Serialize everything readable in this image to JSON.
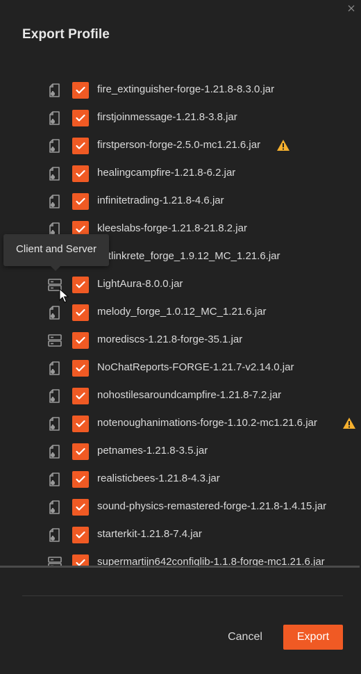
{
  "dialog": {
    "title": "Export Profile",
    "close_icon": "close-icon"
  },
  "mods": [
    {
      "name": "fire_extinguisher-forge-1.21.8-8.3.0.jar",
      "side": "client",
      "checked": true,
      "warning": false
    },
    {
      "name": "firstjoinmessage-1.21.8-3.8.jar",
      "side": "client",
      "checked": true,
      "warning": false
    },
    {
      "name": "firstperson-forge-2.5.0-mc1.21.6.jar",
      "side": "client",
      "checked": true,
      "warning": true
    },
    {
      "name": "healingcampfire-1.21.8-6.2.jar",
      "side": "client",
      "checked": true,
      "warning": false
    },
    {
      "name": "infinitetrading-1.21.8-4.6.jar",
      "side": "client",
      "checked": true,
      "warning": false
    },
    {
      "name": "kleeslabs-forge-1.21.8-21.8.2.jar",
      "side": "client",
      "checked": true,
      "warning": false
    },
    {
      "name": "kotlinkrete_forge_1.9.12_MC_1.21.6.jar",
      "side": "client",
      "checked": true,
      "warning": false
    },
    {
      "name": "LightAura-8.0.0.jar",
      "side": "both",
      "checked": true,
      "warning": false
    },
    {
      "name": "melody_forge_1.0.12_MC_1.21.6.jar",
      "side": "client",
      "checked": true,
      "warning": false
    },
    {
      "name": "morediscs-1.21.8-forge-35.1.jar",
      "side": "both",
      "checked": true,
      "warning": false
    },
    {
      "name": "NoChatReports-FORGE-1.21.7-v2.14.0.jar",
      "side": "client",
      "checked": true,
      "warning": false
    },
    {
      "name": "nohostilesaroundcampfire-1.21.8-7.2.jar",
      "side": "client",
      "checked": true,
      "warning": false
    },
    {
      "name": "notenoughanimations-forge-1.10.2-mc1.21.6.jar",
      "side": "client",
      "checked": true,
      "warning": true
    },
    {
      "name": "petnames-1.21.8-3.5.jar",
      "side": "client",
      "checked": true,
      "warning": false
    },
    {
      "name": "realisticbees-1.21.8-4.3.jar",
      "side": "client",
      "checked": true,
      "warning": false
    },
    {
      "name": "sound-physics-remastered-forge-1.21.8-1.4.15.jar",
      "side": "client",
      "checked": true,
      "warning": false
    },
    {
      "name": "starterkit-1.21.8-7.4.jar",
      "side": "client",
      "checked": true,
      "warning": false
    },
    {
      "name": "supermartijn642configlib-1.1.8-forge-mc1.21.6.jar",
      "side": "both",
      "checked": true,
      "warning": false
    }
  ],
  "tooltip": {
    "text": "Client and Server"
  },
  "footer": {
    "cancel_label": "Cancel",
    "export_label": "Export"
  },
  "colors": {
    "accent": "#f05a24",
    "warning": "#f5b02e",
    "background": "#222222",
    "icon_gray": "#9a9a9a"
  },
  "icons": {
    "client": "client-file-icon",
    "both": "client-and-server-icon",
    "warning": "warning-icon",
    "check": "checkmark-icon"
  }
}
